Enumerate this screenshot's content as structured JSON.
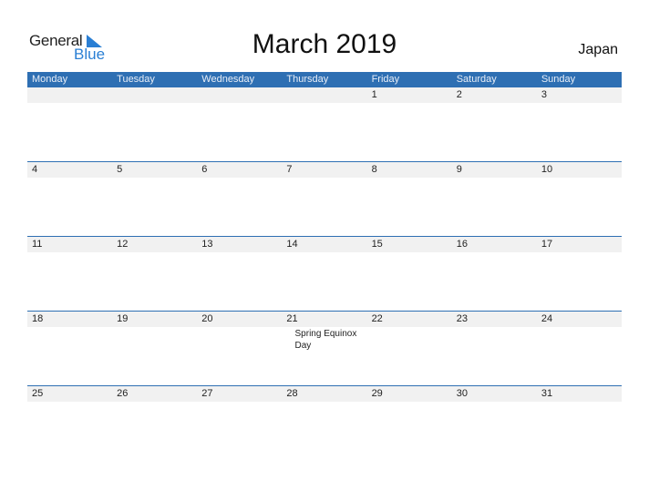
{
  "logo": {
    "line1": "General",
    "line2": "Blue"
  },
  "title": "March 2019",
  "country": "Japan",
  "days": [
    "Monday",
    "Tuesday",
    "Wednesday",
    "Thursday",
    "Friday",
    "Saturday",
    "Sunday"
  ],
  "weeks": [
    {
      "dates": [
        "",
        "",
        "",
        "",
        "1",
        "2",
        "3"
      ],
      "notes": [
        "",
        "",
        "",
        "",
        "",
        "",
        ""
      ]
    },
    {
      "dates": [
        "4",
        "5",
        "6",
        "7",
        "8",
        "9",
        "10"
      ],
      "notes": [
        "",
        "",
        "",
        "",
        "",
        "",
        ""
      ]
    },
    {
      "dates": [
        "11",
        "12",
        "13",
        "14",
        "15",
        "16",
        "17"
      ],
      "notes": [
        "",
        "",
        "",
        "",
        "",
        "",
        ""
      ]
    },
    {
      "dates": [
        "18",
        "19",
        "20",
        "21",
        "22",
        "23",
        "24"
      ],
      "notes": [
        "",
        "",
        "",
        "Spring Equinox Day",
        "",
        "",
        ""
      ]
    },
    {
      "dates": [
        "25",
        "26",
        "27",
        "28",
        "29",
        "30",
        "31"
      ],
      "notes": [
        "",
        "",
        "",
        "",
        "",
        "",
        ""
      ]
    }
  ],
  "colors": {
    "header": "#2e6fb3",
    "accent": "#2a7fd4",
    "row": "#f1f1f1"
  }
}
